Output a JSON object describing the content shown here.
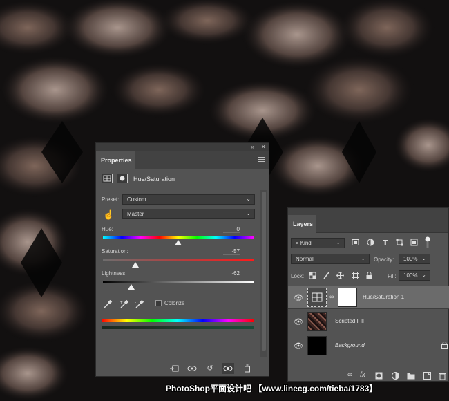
{
  "properties": {
    "tab": "Properties",
    "adjustment_title": "Hue/Saturation",
    "preset_label": "Preset:",
    "preset_value": "Custom",
    "channel_value": "Master",
    "hue": {
      "label": "Hue:",
      "value": "0",
      "position": 0.5
    },
    "saturation": {
      "label": "Saturation:",
      "value": "-57",
      "position": 0.215
    },
    "lightness": {
      "label": "Lightness:",
      "value": "-62",
      "position": 0.19
    },
    "colorize_label": "Colorize",
    "colorize_checked": false,
    "icons": {
      "collapse": "«",
      "close": "✕",
      "hand": "☝",
      "chevron": "⌄",
      "eyedropper": "eyedropper-icon",
      "clip": "clip-to-layer-icon",
      "view_previous": "view-previous-icon",
      "reset": "↺",
      "visibility": "👁",
      "delete": "🗑"
    }
  },
  "layers": {
    "tab": "Layers",
    "kind_label": "Kind",
    "blend_mode": "Normal",
    "opacity_label": "Opacity:",
    "opacity_value": "100%",
    "lock_label": "Lock:",
    "fill_label": "Fill:",
    "fill_value": "100%",
    "items": [
      {
        "name": "Hue/Saturation 1",
        "selected": true,
        "italic": false
      },
      {
        "name": "Scripted Fill",
        "selected": false,
        "italic": false
      },
      {
        "name": "Background",
        "selected": false,
        "italic": true
      }
    ],
    "bottom_icons": [
      "link-icon",
      "fx-icon",
      "mask-icon",
      "adjustment-icon",
      "folder-icon",
      "new-layer-icon",
      "delete-icon"
    ]
  },
  "watermark": "PhotoShop平面设计吧 【www.linecg.com/tieba/1783】"
}
